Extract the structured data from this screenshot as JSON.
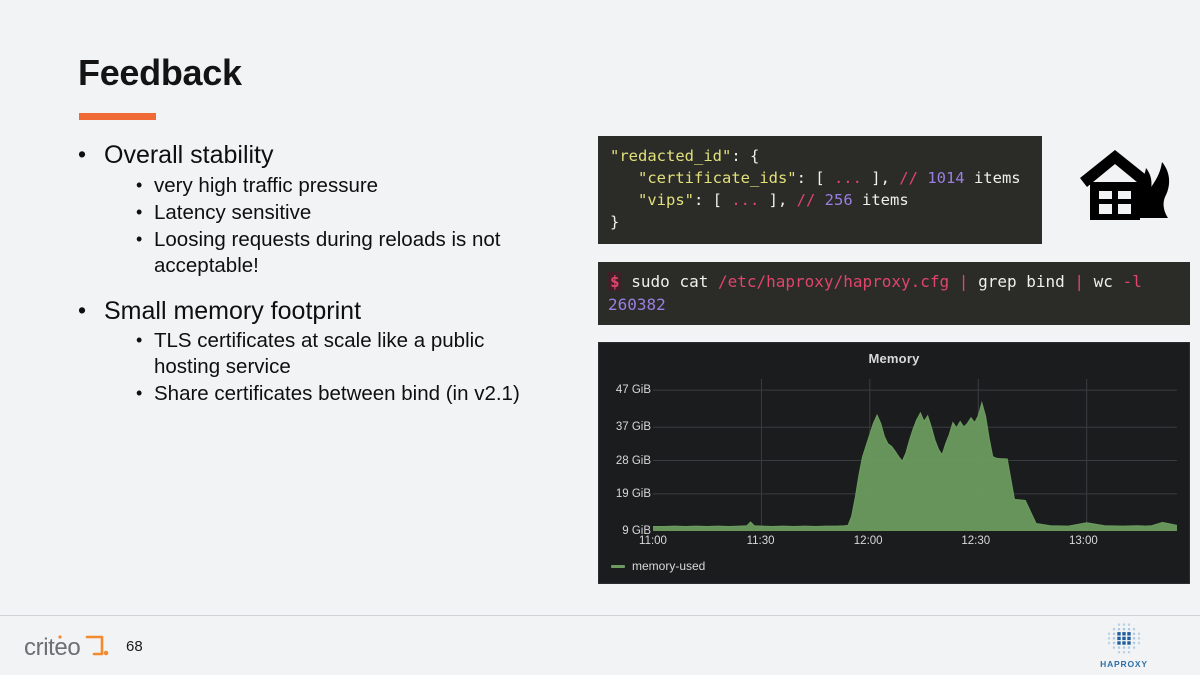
{
  "slide": {
    "title": "Feedback",
    "page_number": "68",
    "background_color": "#f2f3f5",
    "accent_color": "#ef6a35"
  },
  "bullets": [
    {
      "level1": "Overall stability",
      "level2": [
        "very high traffic pressure",
        "Latency sensitive",
        "Loosing requests during reloads is not acceptable!"
      ]
    },
    {
      "level1": "Small memory footprint",
      "level2": [
        "TLS certificates at scale like a public hosting service",
        "Share certificates between bind (in v2.1)"
      ]
    }
  ],
  "json_block": {
    "line1_key": "\"redacted_id\"",
    "line1_punc": ": {",
    "line2_key": "\"certificate_ids\"",
    "line2_open": ": [ ",
    "line2_dots": "...",
    "line2_close": " ], ",
    "line2_comment": "//",
    "line2_count": "1014",
    "line2_tail": " items",
    "line3_key": "\"vips\"",
    "line3_open": ": [ ",
    "line3_dots": "...",
    "line3_close": " ], ",
    "line3_comment": "//",
    "line3_count": "256",
    "line3_tail": " items",
    "line4_punc": "}",
    "background": "#2b2b28"
  },
  "terminal": {
    "prompt": "$",
    "cmd_1": " sudo cat ",
    "path_1": "/etc/haproxy/haproxy.cfg",
    "pipe_1": " | ",
    "cmd_2": "grep bind",
    "pipe_2": " | ",
    "cmd_3": "wc ",
    "flag": "-l",
    "output": "260382",
    "background": "#2b2b28"
  },
  "chart_data": {
    "type": "area",
    "title": "Memory",
    "xlabel": "",
    "ylabel": "",
    "grid": true,
    "legend_position": "bottom-left",
    "series": [
      {
        "name": "memory-used",
        "color": "#6b9b5e"
      }
    ],
    "legend": [
      "memory-used"
    ],
    "ytick_labels": [
      "47 GiB",
      "37 GiB",
      "28 GiB",
      "19 GiB",
      "9 GiB"
    ],
    "ytick_values": [
      47,
      37,
      28,
      19,
      9
    ],
    "ylim": [
      9,
      50
    ],
    "xtick_labels": [
      "11:00",
      "11:30",
      "12:00",
      "12:30",
      "13:00"
    ],
    "xtick_values": [
      0,
      30,
      60,
      90,
      120
    ],
    "xlim": [
      0,
      145
    ],
    "x": [
      0,
      3,
      6,
      9,
      12,
      15,
      18,
      21,
      24,
      26,
      27,
      28,
      30,
      33,
      36,
      39,
      42,
      45,
      48,
      51,
      53,
      54,
      55,
      56,
      57,
      58,
      59,
      60,
      61,
      62,
      63,
      64,
      65,
      66,
      67,
      68,
      69,
      70,
      71,
      72,
      73,
      74,
      75,
      76,
      77,
      78,
      79,
      80,
      81,
      82,
      83,
      84,
      85,
      86,
      87,
      88,
      89,
      90,
      91,
      92,
      93,
      94,
      95,
      96,
      98,
      100,
      103,
      106,
      110,
      115,
      120,
      125,
      130,
      134,
      136,
      138,
      141,
      145
    ],
    "y": [
      10.2,
      10.2,
      10.3,
      10.2,
      10.3,
      10.2,
      10.3,
      10.2,
      10.3,
      10.4,
      11.4,
      10.4,
      10.3,
      10.2,
      10.3,
      10.2,
      10.3,
      10.2,
      10.3,
      10.3,
      10.4,
      10.5,
      13.0,
      18.0,
      24.0,
      29.0,
      32.0,
      35.0,
      38.0,
      40.2,
      38.0,
      34.5,
      32.5,
      31.8,
      30.5,
      29.0,
      27.8,
      30.0,
      33.5,
      36.5,
      39.0,
      40.8,
      38.5,
      40.0,
      37.0,
      33.5,
      31.0,
      29.5,
      32.5,
      35.0,
      38.2,
      36.8,
      38.5,
      37.0,
      38.0,
      39.5,
      38.2,
      40.0,
      43.5,
      40.0,
      34.0,
      29.0,
      28.6,
      28.5,
      28.4,
      17.5,
      17.2,
      11.0,
      10.4,
      10.3,
      11.2,
      10.4,
      10.3,
      10.4,
      10.3,
      10.4,
      11.3,
      10.5
    ]
  },
  "icons": {
    "house_on_fire": "house-on-fire-icon",
    "haproxy_wordmark": "HAPROXY"
  },
  "footer": {
    "brand": "criteo",
    "brand_color": "#6e6e73",
    "brand_accent": "#f28a2e",
    "haproxy_color": "#2e6fa8"
  }
}
